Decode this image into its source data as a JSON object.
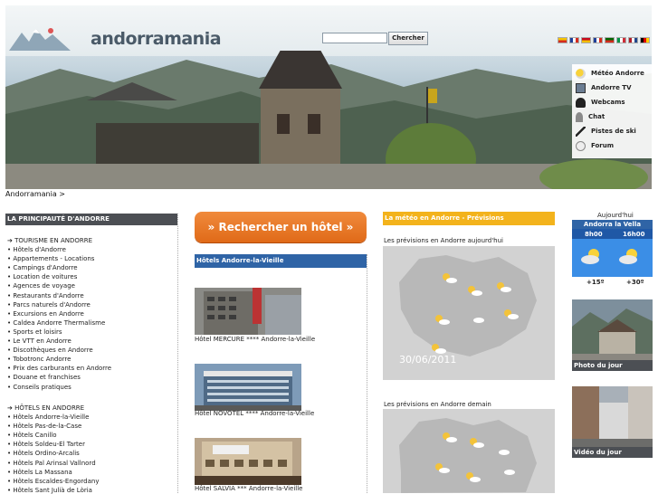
{
  "header": {
    "site_name": "andorramania",
    "search": {
      "value": "",
      "button_label": "Chercher"
    },
    "flags": [
      {
        "name": "catalan-flag",
        "colors": [
          "#f4c400",
          "#d52b1e"
        ]
      },
      {
        "name": "french-flag",
        "colors": [
          "#1f3f99",
          "#ffffff",
          "#d52b1e"
        ]
      },
      {
        "name": "spanish-flag",
        "colors": [
          "#c60b1e",
          "#f1bf00"
        ]
      },
      {
        "name": "uk-flag",
        "colors": [
          "#1f3f99",
          "#ffffff",
          "#d52b1e"
        ]
      },
      {
        "name": "portuguese-flag",
        "colors": [
          "#006600",
          "#d52b1e"
        ]
      },
      {
        "name": "italian-flag",
        "colors": [
          "#009246",
          "#ffffff",
          "#ce2b37"
        ]
      },
      {
        "name": "dutch-flag",
        "colors": [
          "#ae1c28",
          "#ffffff",
          "#21468b"
        ]
      },
      {
        "name": "german-flag",
        "colors": [
          "#000000",
          "#dd0000",
          "#ffce00"
        ]
      },
      {
        "name": "chinese-flag",
        "colors": [
          "#de2910",
          "#ffde00"
        ]
      }
    ],
    "side_menu": [
      {
        "label": "Météo Andorre",
        "icon": "weather-icon"
      },
      {
        "label": "Andorre TV",
        "icon": "tv-icon"
      },
      {
        "label": "Webcams",
        "icon": "webcam-icon"
      },
      {
        "label": "Chat",
        "icon": "chat-icon"
      },
      {
        "label": "Pistes de ski",
        "icon": "skier-icon"
      },
      {
        "label": "Forum",
        "icon": "forum-icon"
      }
    ]
  },
  "breadcrumb": "Andorramania >",
  "left": {
    "heading": "LA PRINCIPAUTÉ D'ANDORRE",
    "tourism_title": "➔ TOURISME EN ANDORRE",
    "tourism_links": [
      "• Hôtels d'Andorre",
      "• Appartements - Locations",
      "• Campings d'Andorre",
      "• Location de voitures",
      "• Agences de voyage",
      "• Restaurants d'Andorre",
      "• Parcs naturels d'Andorre",
      "• Excursions en Andorre",
      "• Caldea Andorre Thermalisme",
      "• Sports et loisirs",
      "• Le VTT en Andorre",
      "• Discothèques en Andorre",
      "• Tobotronc Andorre",
      "• Prix des carburants en Andorre",
      "• Douane et franchises",
      "• Conseils pratiques"
    ],
    "hotels_title": "➔ HÔTELS EN ANDORRE",
    "hotels_links": [
      "• Hôtels Andorre-la-Vieille",
      "• Hôtels Pas-de-la-Case",
      "• Hôtels Canillo",
      "• Hôtels Soldeu-El Tarter",
      "• Hôtels Ordino-Arcalis",
      "• Hôtels Pal Arinsal Vallnord",
      "• Hôtels La Massana",
      "• Hôtels Escaldes-Engordany",
      "• Hôtels Sant Julià de Lòria"
    ]
  },
  "middle": {
    "search_hotel_button": "» Rechercher un hôtel »",
    "hotels_heading": "Hôtels Andorre-la-Vieille",
    "hotels": [
      {
        "caption": "Hôtel MERCURE **** Andorre-la-Vieille"
      },
      {
        "caption": "Hôtel NOVOTEL **** Andorre-la-Vieille"
      },
      {
        "caption": "Hôtel SALVIA *** Andorre-la-Vieille"
      }
    ]
  },
  "weather": {
    "heading": "La météo en Andorre - Prévisions",
    "today_label": "Les prévisions en Andorre aujourd'hui",
    "map_date": "30/06/2011",
    "tomorrow_label": "Les prévisions en Andorre demain"
  },
  "right": {
    "today": "Aujourd'hui",
    "city": "Andorra la Vella",
    "times": [
      "8h00",
      "16h00"
    ],
    "temps": [
      "+15º",
      "+30º"
    ],
    "photo_caption": "Photo du jour",
    "video_caption": "Vidéo du jour"
  }
}
